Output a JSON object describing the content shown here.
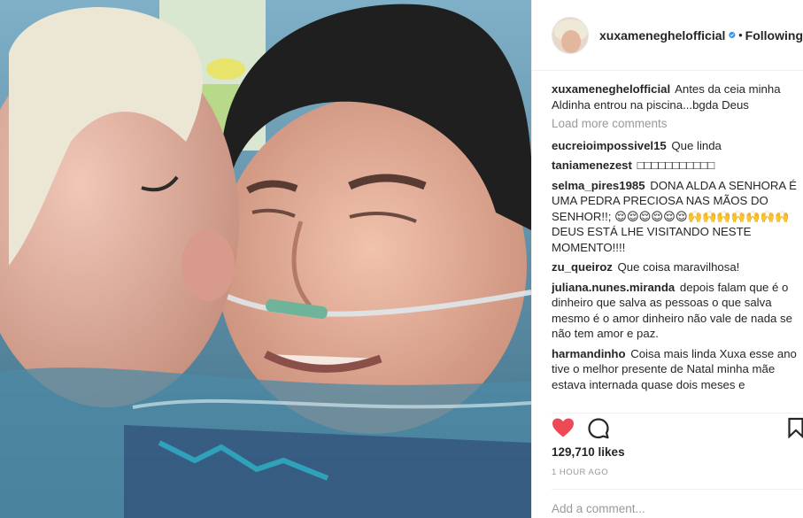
{
  "photo": {
    "alt": ""
  },
  "header": {
    "username": "xuxameneghelofficial",
    "separator": "•",
    "follow_label": "Following"
  },
  "caption": {
    "user": "xuxameneghelofficial",
    "text": "Antes da ceia minha Aldinha entrou na piscina...bgda Deus"
  },
  "load_more": "Load more comments",
  "comments": [
    {
      "user": "eucreioimpossivel15",
      "text": "Que linda"
    },
    {
      "user": "taniamenezest",
      "text": "□□□□□□□□□□□"
    },
    {
      "user": "selma_pires1985",
      "text": "DONA ALDA A SENHORA É UMA PEDRA PRECIOSA NAS MÃOS DO SENHOR!!; 😌😌😌😌😌😌🙌🙌🙌🙌🙌🙌🙌 DEUS ESTÁ LHE VISITANDO NESTE MOMENTO!!!!"
    },
    {
      "user": "zu_queiroz",
      "text": "Que coisa maravilhosa!"
    },
    {
      "user": "juliana.nunes.miranda",
      "text": "depois falam que é o dinheiro que salva as pessoas o que salva mesmo é o amor dinheiro não vale de nada se não tem amor e paz."
    },
    {
      "user": "harmandinho",
      "text": "Coisa mais linda Xuxa esse ano tive o melhor presente de Natal minha mãe estava internada quase dois meses e"
    }
  ],
  "likes": "129,710 likes",
  "time_ago": "1 HOUR AGO",
  "add_comment_placeholder": "Add a comment...",
  "colors": {
    "verified": "#3897f0",
    "liked_heart": "#ed4956",
    "muted_text": "#999999",
    "primary_text": "#262626"
  },
  "icons": {
    "verified": "verified-badge-icon",
    "like": "heart-filled-icon",
    "comment": "speech-bubble-icon",
    "save": "bookmark-icon"
  }
}
